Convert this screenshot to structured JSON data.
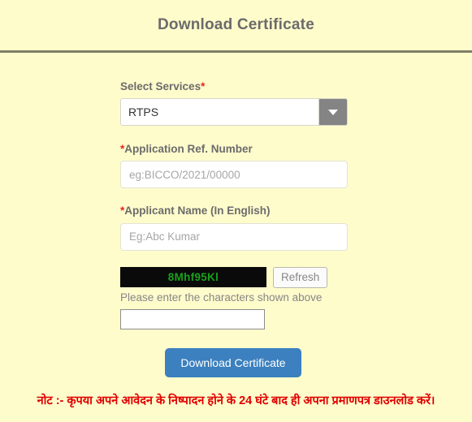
{
  "header": {
    "title": "Download Certificate"
  },
  "form": {
    "service": {
      "label": "Select Services",
      "required_mark": "*",
      "selected": "RTPS",
      "arrow_icon": "chevron-down-icon"
    },
    "app_ref": {
      "required_mark": "*",
      "label": "Application Ref. Number",
      "value": "",
      "placeholder": "eg:BICCO/2021/00000"
    },
    "applicant_name": {
      "required_mark": "*",
      "label": "Applicant Name (In English)",
      "value": "",
      "placeholder": "Eg:Abc Kumar"
    },
    "captcha": {
      "code": "8Mhf95Kl",
      "refresh_label": "Refresh",
      "hint": "Please enter the characters shown above",
      "value": "",
      "placeholder": ""
    },
    "submit_label": "Download Certificate"
  },
  "footer": {
    "note": "नोट :- कृपया अपने आवेदन के निष्पादन होने के 24 घंटे बाद ही अपना प्रमाणपत्र डाउनलोड करें।"
  },
  "colors": {
    "page_background": "#FFFCCC",
    "title_text": "#6B6B6B",
    "rule": "#7F7F66",
    "required_star": "#E8231F",
    "captcha_background": "#0A0A0A",
    "captcha_text": "#1AA01A",
    "submit_button": "#3C80BF",
    "footer_note": "#E00000",
    "select_arrow_button": "#848484"
  }
}
